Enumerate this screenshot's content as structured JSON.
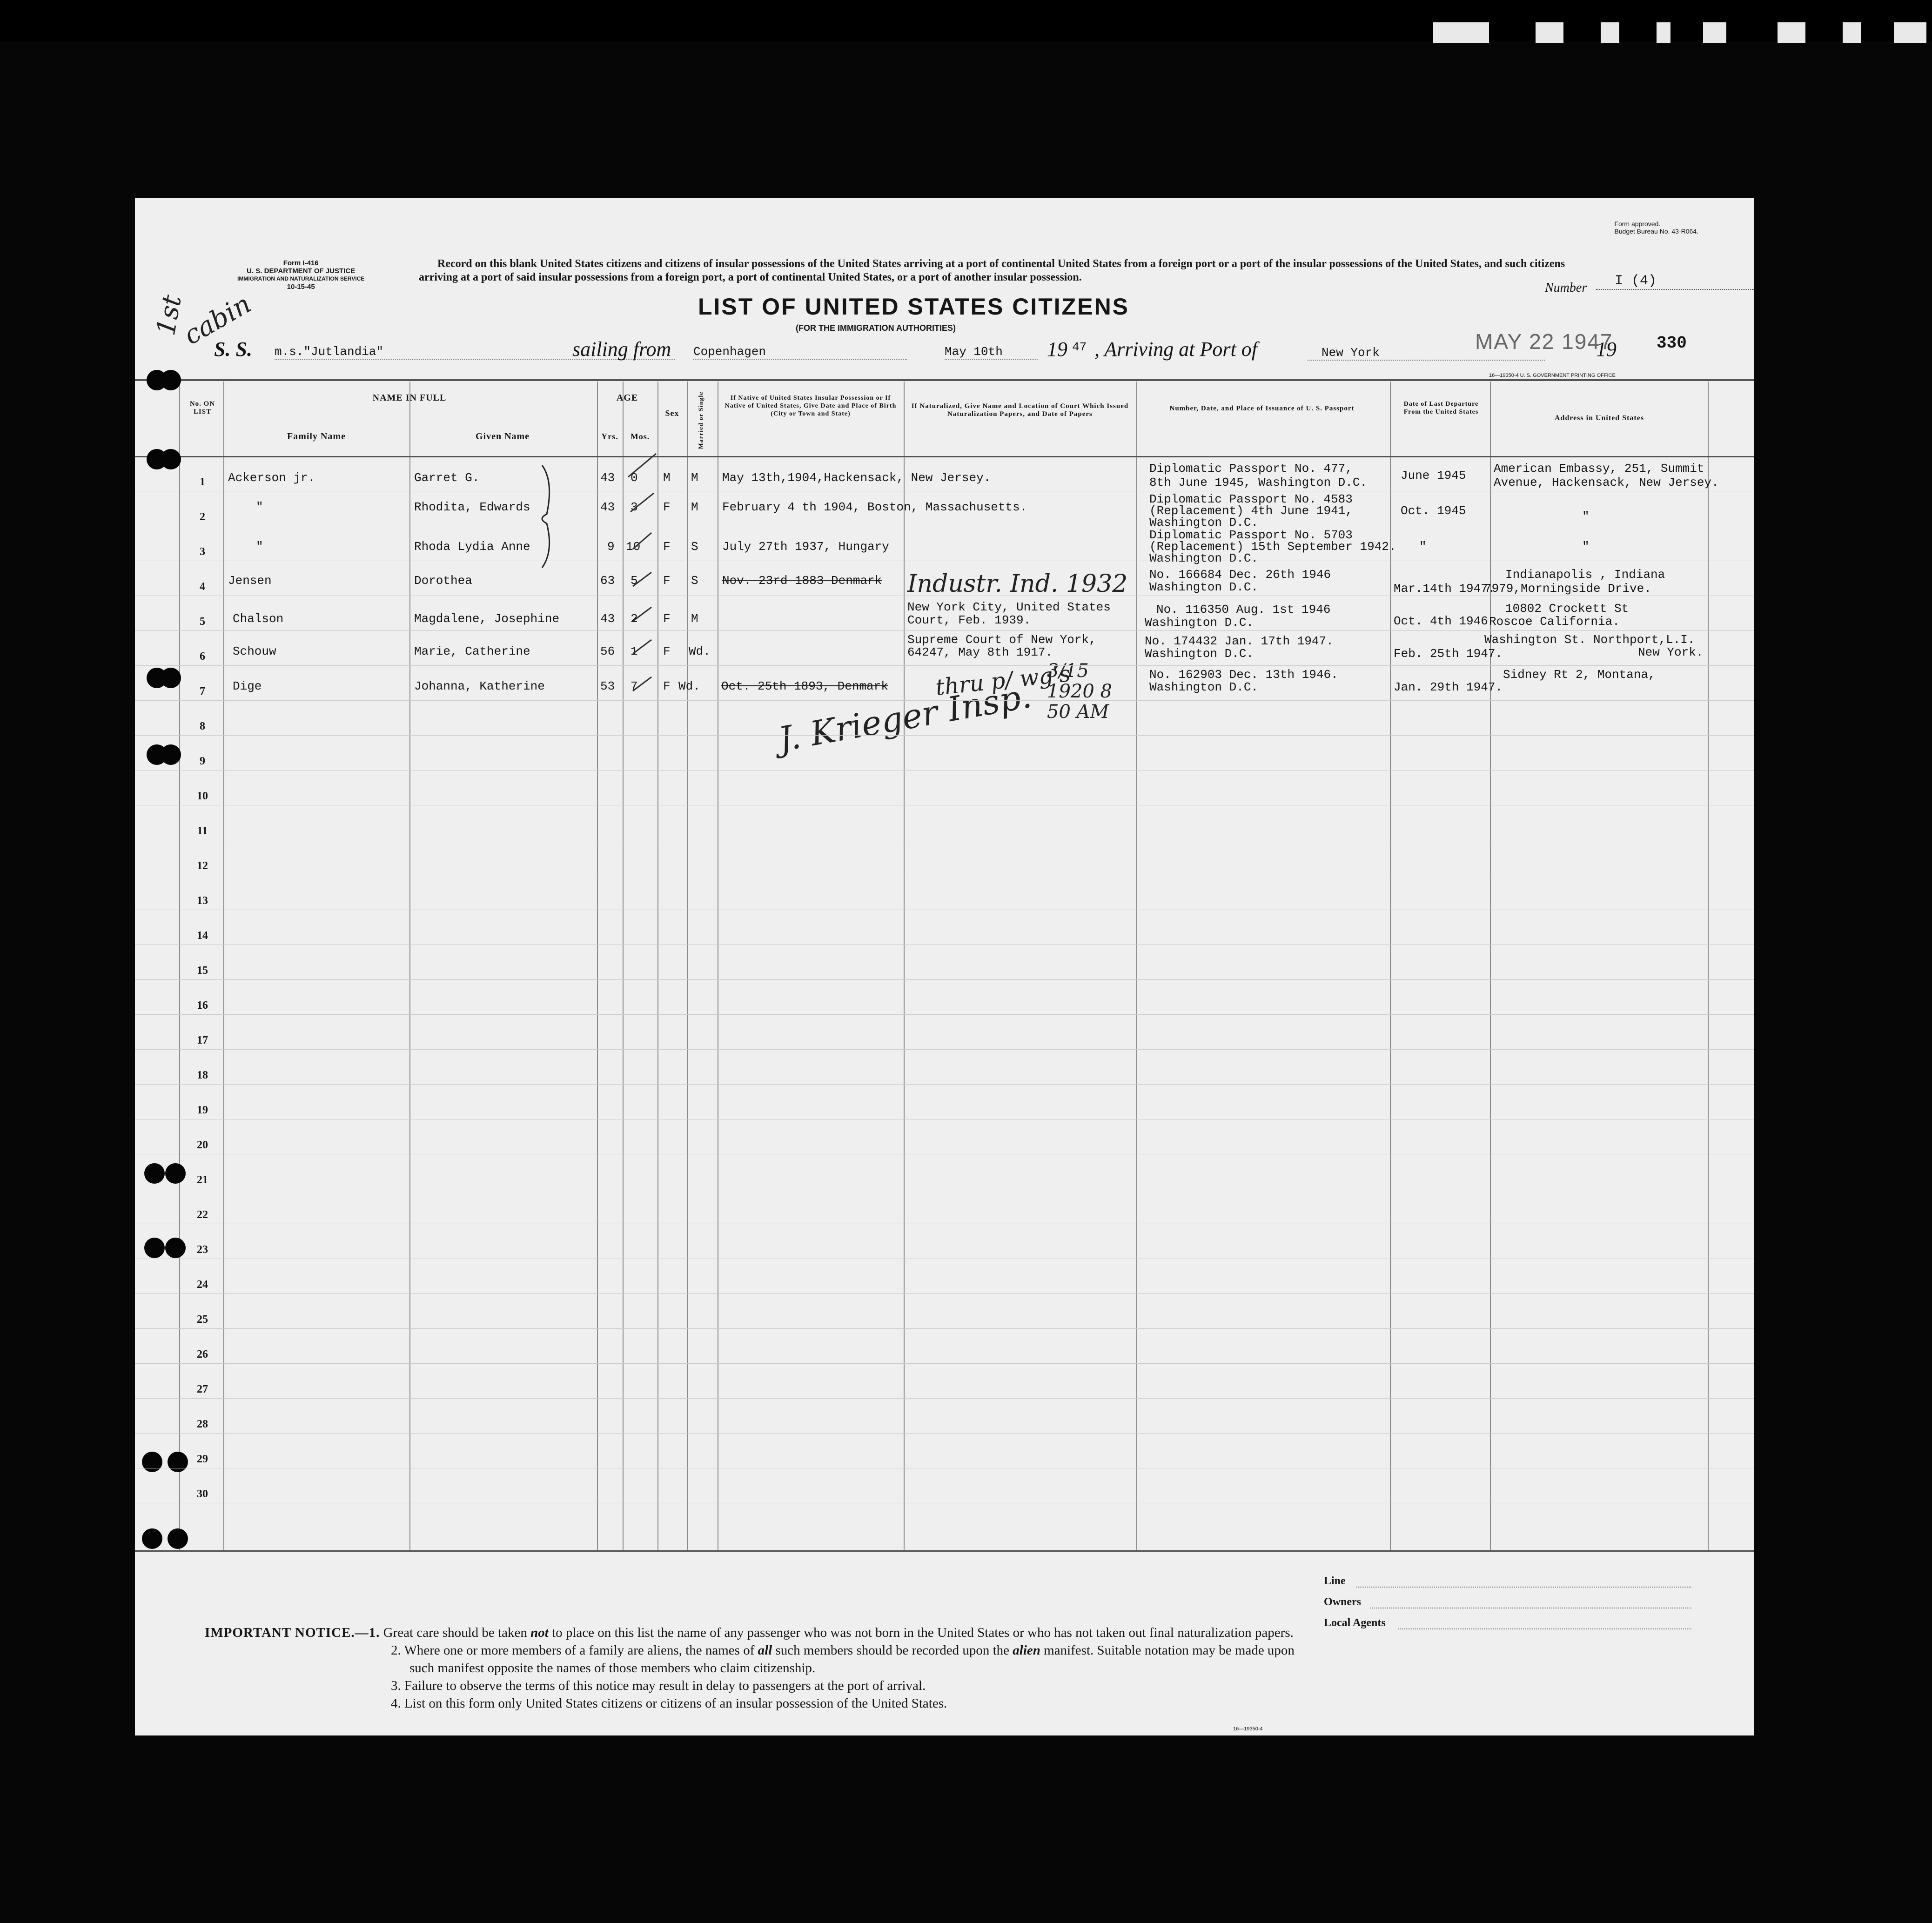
{
  "form": {
    "form_number": "Form I-416",
    "department": "U. S. DEPARTMENT OF JUSTICE",
    "service": "IMMIGRATION AND NATURALIZATION SERVICE",
    "form_date": "10-15-45",
    "approval_line1": "Form approved.",
    "approval_line2": "Budget Bureau No. 43-R064.",
    "record_text": "Record on this blank United States citizens and citizens of insular possessions of the United States arriving at a port of continental United States from a foreign port or a port of the insular possessions of the United States, and such citizens arriving at a port of said insular possessions from a foreign port, a port of continental United States, or a port of another insular possession.",
    "title": "LIST OF UNITED STATES CITIZENS",
    "subtitle": "(FOR THE IMMIGRATION AUTHORITIES)",
    "number_label": "Number",
    "number_value": "I (4)",
    "printing_note": "16—19350-4 U. S. GOVERNMENT PRINTING OFFICE",
    "bottom_code": "16—19350-4"
  },
  "handwritten": {
    "class_note_1": "1st",
    "class_note_2": "cabin",
    "naturalized_1932": "Industr. Ind. 1932",
    "signature": "J. Krieger Insp.",
    "time_note": "thru p/ wg's",
    "bracket_note": "3/15 1920 8 50 AM"
  },
  "voyage": {
    "ss_label": "S. S.",
    "vessel": "m.s.\"Jutlandia\"",
    "sailing_label": "sailing from",
    "from": "Copenhagen",
    "date": "May 10th",
    "year_prefix": "19",
    "year_suffix": "47",
    "arriving_label": ", Arriving at Port of",
    "port": "New York",
    "stamp_date": "MAY 22 1947",
    "year2_prefix": "19",
    "page_number": "330"
  },
  "headers": {
    "no_on_list": "No. ON LIST",
    "name_in_full": "NAME IN FULL",
    "family_name": "Family Name",
    "given_name": "Given Name",
    "age": "AGE",
    "yrs": "Yrs.",
    "mos": "Mos.",
    "sex": "Sex",
    "married": "Married or Single",
    "native": "If Native of United States Insular Possession or If Native of United States, Give Date and Place of Birth (City or Town and State)",
    "naturalized": "If Naturalized, Give Name and Location of Court Which Issued Naturalization Papers, and Date of Papers",
    "passport": "Number, Date, and Place of Issuance of U. S. Passport",
    "departure": "Date of Last Departure From the United States",
    "address": "Address in United States"
  },
  "rows": [
    {
      "no": "1",
      "family": "Ackerson jr.",
      "given": "Garret G.",
      "yrs": "43",
      "mos": "0",
      "sex": "M",
      "ms": "M",
      "birth": "May 13th,1904,Hackensack, New Jersey.",
      "nat1": "",
      "nat2": "",
      "pass1": "Diplomatic Passport No. 477,",
      "pass2": "8th June 1945, Washington D.C.",
      "pass3": "",
      "dep": "June 1945",
      "addr1": "American Embassy, 251, Summit",
      "addr2": "Avenue, Hackensack, New Jersey."
    },
    {
      "no": "2",
      "family": "\"",
      "given": "Rhodita, Edwards",
      "yrs": "43",
      "mos": "3",
      "sex": "F",
      "ms": "M",
      "birth": "February 4 th 1904, Boston, Massachusetts.",
      "nat1": "",
      "nat2": "",
      "pass1": "Diplomatic Passport No. 4583",
      "pass2": "(Replacement) 4th June 1941,",
      "pass3": "Washington D.C.",
      "dep": "Oct. 1945",
      "addr1": "\"",
      "addr2": ""
    },
    {
      "no": "3",
      "family": "\"",
      "given": "Rhoda Lydia Anne",
      "yrs": "9",
      "mos": "10",
      "sex": "F",
      "ms": "S",
      "birth": "July 27th 1937, Hungary",
      "nat1": "",
      "nat2": "",
      "pass1": "Diplomatic Passport No. 5703",
      "pass2": "(Replacement) 15th September 1942.",
      "pass3": "Washington D.C.",
      "dep": "\"",
      "addr1": "\"",
      "addr2": ""
    },
    {
      "no": "4",
      "family": "Jensen",
      "given": "Dorothea",
      "yrs": "63",
      "mos": "5",
      "sex": "F",
      "ms": "S",
      "birth": "Nov. 23rd 1883 Denmark",
      "nat1": "",
      "nat2": "",
      "pass1": "No. 166684 Dec. 26th 1946",
      "pass2": "Washington D.C.",
      "pass3": "",
      "dep": "Mar.14th 1947.",
      "addr1": "Indianapolis , Indiana",
      "addr2": "7979,Morningside Drive."
    },
    {
      "no": "5",
      "family": "Chalson",
      "given": "Magdalene, Josephine",
      "yrs": "43",
      "mos": "2",
      "sex": "F",
      "ms": "M",
      "birth": "",
      "nat1": "New York City, United States",
      "nat2": "Court, Feb. 1939.",
      "pass1": "No. 116350  Aug. 1st 1946",
      "pass2": "Washington D.C.",
      "pass3": "",
      "dep": "Oct. 4th 1946",
      "addr1": "10802 Crockett St",
      "addr2": "Roscoe California."
    },
    {
      "no": "6",
      "family": "Schouw",
      "given": "Marie, Catherine",
      "yrs": "56",
      "mos": "1",
      "sex": "F",
      "ms": "Wd.",
      "birth": "",
      "nat1": "Supreme Court of New York,",
      "nat2": "64247, May 8th 1917.",
      "pass1": "No. 174432 Jan. 17th 1947.",
      "pass2": "Washington D.C.",
      "pass3": "",
      "dep": "Feb. 25th 1947.",
      "addr1": "Washington St. Northport,L.I.",
      "addr2": "New York."
    },
    {
      "no": "7",
      "family": "Dige",
      "given": "Johanna, Katherine",
      "yrs": "53",
      "mos": "7",
      "sex": "F",
      "ms": "Wd.",
      "birth": "Oct. 25th 1893, Denmark",
      "nat1": "",
      "nat2": "",
      "pass1": "No. 162903 Dec. 13th 1946.",
      "pass2": "Washington D.C.",
      "pass3": "",
      "dep": "Jan. 29th 1947.",
      "addr1": "Sidney Rt 2, Montana,",
      "addr2": ""
    }
  ],
  "row_numbers": [
    "1",
    "2",
    "3",
    "4",
    "5",
    "6",
    "7",
    "8",
    "9",
    "10",
    "11",
    "12",
    "13",
    "14",
    "15",
    "16",
    "17",
    "18",
    "19",
    "20",
    "21",
    "22",
    "23",
    "24",
    "25",
    "26",
    "27",
    "28",
    "29",
    "30"
  ],
  "footer": {
    "line_label": "Line",
    "owners_label": "Owners",
    "agents_label": "Local Agents",
    "notice_lead": "IMPORTANT NOTICE.—1.",
    "n1a": "Great care should be taken",
    "n1b": "not",
    "n1c": "to place on this list the name of any passenger who was not born in the United States or who has not taken out final naturalization papers.",
    "n2a": "2. Where one or more members of a family are aliens, the names of",
    "n2b": "all",
    "n2c": "such members should be recorded upon the",
    "n2d": "alien",
    "n2e": "manifest.  Suitable notation may be made upon",
    "n2f": "such manifest opposite the names of those members who claim citizenship.",
    "n3": "3. Failure to observe the terms of this notice may result in delay to passengers at the port of arrival.",
    "n4": "4. List on this form only United States citizens or citizens of an insular possession of the United States."
  }
}
